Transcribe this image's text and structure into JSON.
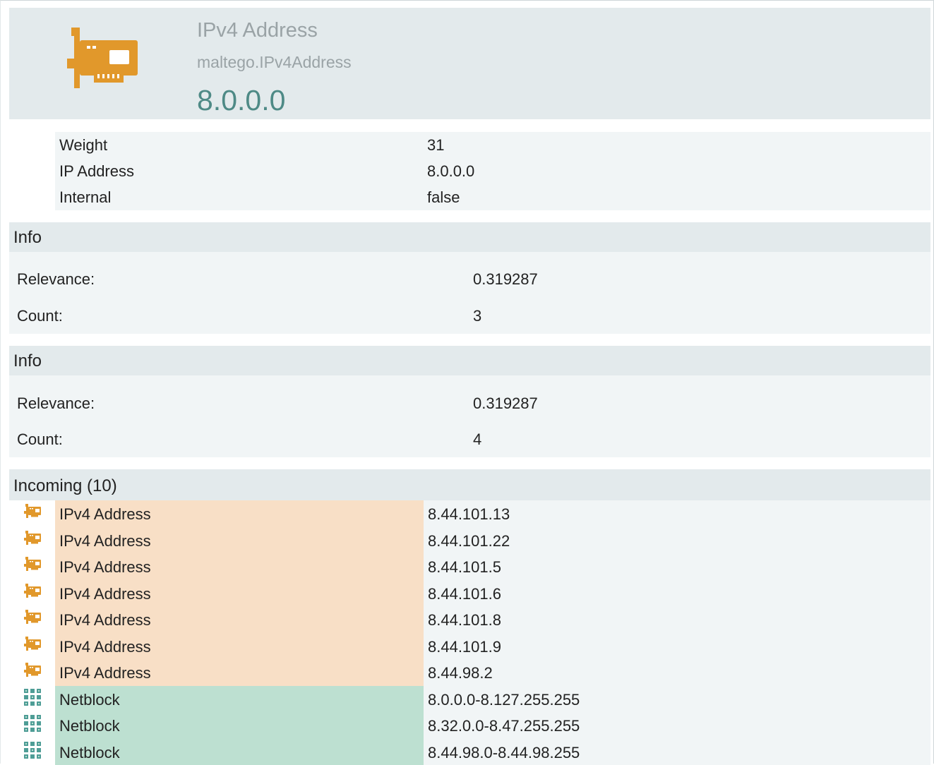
{
  "header": {
    "type_name": "IPv4 Address",
    "type_id": "maltego.IPv4Address",
    "value": "8.0.0.0",
    "icon": "network-card-icon"
  },
  "properties": [
    {
      "key": "Weight",
      "value": "31"
    },
    {
      "key": "IP Address",
      "value": "8.0.0.0"
    },
    {
      "key": "Internal",
      "value": "false"
    }
  ],
  "info_sections": [
    {
      "title": "Info",
      "rows": [
        {
          "key": "Relevance:",
          "value": "0.319287"
        },
        {
          "key": "Count:",
          "value": "3"
        }
      ]
    },
    {
      "title": "Info",
      "rows": [
        {
          "key": "Relevance:",
          "value": "0.319287"
        },
        {
          "key": "Count:",
          "value": "4"
        }
      ]
    }
  ],
  "incoming": {
    "title": "Incoming (10)",
    "rows": [
      {
        "icon": "network-card-icon",
        "type": "IPv4 Address",
        "value": "8.44.101.13"
      },
      {
        "icon": "network-card-icon",
        "type": "IPv4 Address",
        "value": "8.44.101.22"
      },
      {
        "icon": "network-card-icon",
        "type": "IPv4 Address",
        "value": "8.44.101.5"
      },
      {
        "icon": "network-card-icon",
        "type": "IPv4 Address",
        "value": "8.44.101.6"
      },
      {
        "icon": "network-card-icon",
        "type": "IPv4 Address",
        "value": "8.44.101.8"
      },
      {
        "icon": "network-card-icon",
        "type": "IPv4 Address",
        "value": "8.44.101.9"
      },
      {
        "icon": "network-card-icon",
        "type": "IPv4 Address",
        "value": "8.44.98.2"
      },
      {
        "icon": "netblock-icon",
        "type": "Netblock",
        "value": "8.0.0.0-8.127.255.255"
      },
      {
        "icon": "netblock-icon",
        "type": "Netblock",
        "value": "8.32.0.0-8.47.255.255"
      },
      {
        "icon": "netblock-icon",
        "type": "Netblock",
        "value": "8.44.98.0-8.44.98.255"
      }
    ]
  },
  "colors": {
    "ipv4_row": "#f8dfc6",
    "netblock_row": "#bde0d1",
    "section_bg": "#e3eaec",
    "body_bg": "#f1f5f6",
    "entity_value": "#4e8a86",
    "icon_orange": "#e1982b",
    "icon_teal": "#4e9d96"
  }
}
